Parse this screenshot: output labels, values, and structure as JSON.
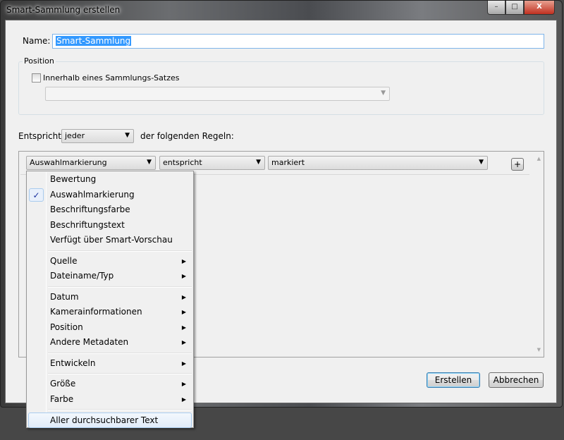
{
  "window": {
    "title": "Smart-Sammlung erstellen",
    "minimize": "–",
    "maximize": "□",
    "close": "X"
  },
  "name": {
    "label": "Name:",
    "value": "Smart-Sammlung"
  },
  "position": {
    "group_label": "Position",
    "checkbox_label": "Innerhalb eines Sammlungs-Satzes",
    "checked": false,
    "set_value": ""
  },
  "match": {
    "prefix": "Entspricht",
    "value": "jeder",
    "suffix": "der folgenden Regeln:"
  },
  "rule": {
    "field": "Auswahlmarkierung",
    "operator": "entspricht",
    "value": "markiert",
    "add": "+"
  },
  "menu": [
    {
      "label": "Bewertung"
    },
    {
      "label": "Auswahlmarkierung",
      "checked": true
    },
    {
      "label": "Beschriftungsfarbe"
    },
    {
      "label": "Beschriftungstext"
    },
    {
      "label": "Verfügt über Smart-Vorschau"
    },
    {
      "sep": true
    },
    {
      "label": "Quelle",
      "submenu": true
    },
    {
      "label": "Dateiname/Typ",
      "submenu": true
    },
    {
      "sep": true
    },
    {
      "label": "Datum",
      "submenu": true
    },
    {
      "label": "Kamerainformationen",
      "submenu": true
    },
    {
      "label": "Position",
      "submenu": true
    },
    {
      "label": "Andere Metadaten",
      "submenu": true
    },
    {
      "sep": true
    },
    {
      "label": "Entwickeln",
      "submenu": true
    },
    {
      "sep": true
    },
    {
      "label": "Größe",
      "submenu": true
    },
    {
      "label": "Farbe",
      "submenu": true
    },
    {
      "sep": true
    },
    {
      "label": "Aller durchsuchbarer Text",
      "highlighted": true
    }
  ],
  "buttons": {
    "create": "Erstellen",
    "cancel": "Abbrechen"
  }
}
